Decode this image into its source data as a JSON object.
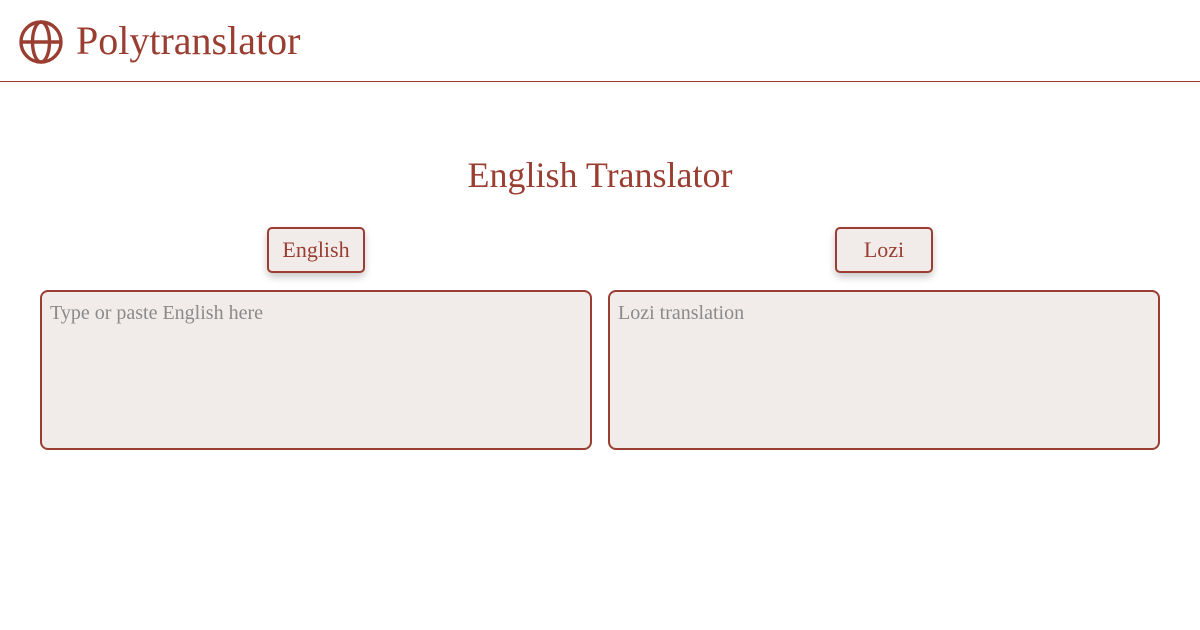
{
  "header": {
    "logo_icon": "globe-icon",
    "app_title": "Polytranslator"
  },
  "main": {
    "page_title": "English Translator",
    "source_language": "English",
    "target_language": "Lozi",
    "source_input": {
      "value": "",
      "placeholder": "Type or paste English here"
    },
    "target_output": {
      "value": "",
      "placeholder": "Lozi translation"
    }
  },
  "colors": {
    "accent": "#9a3e32",
    "field_background": "#f1ebea",
    "placeholder": "#8a8a8a"
  }
}
